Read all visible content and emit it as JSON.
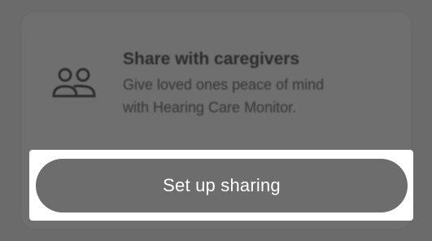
{
  "card": {
    "icon": "people-icon",
    "title": "Share with caregivers",
    "subtitle_line1": "Give loved ones peace of mind",
    "subtitle_line2": "with Hearing Care Monitor."
  },
  "cta": {
    "label": "Set up sharing"
  },
  "colors": {
    "overlay": "#6b6b6b",
    "highlight": "#ffffff",
    "button": "#6d6d6d",
    "button_text": "#ffffff"
  }
}
